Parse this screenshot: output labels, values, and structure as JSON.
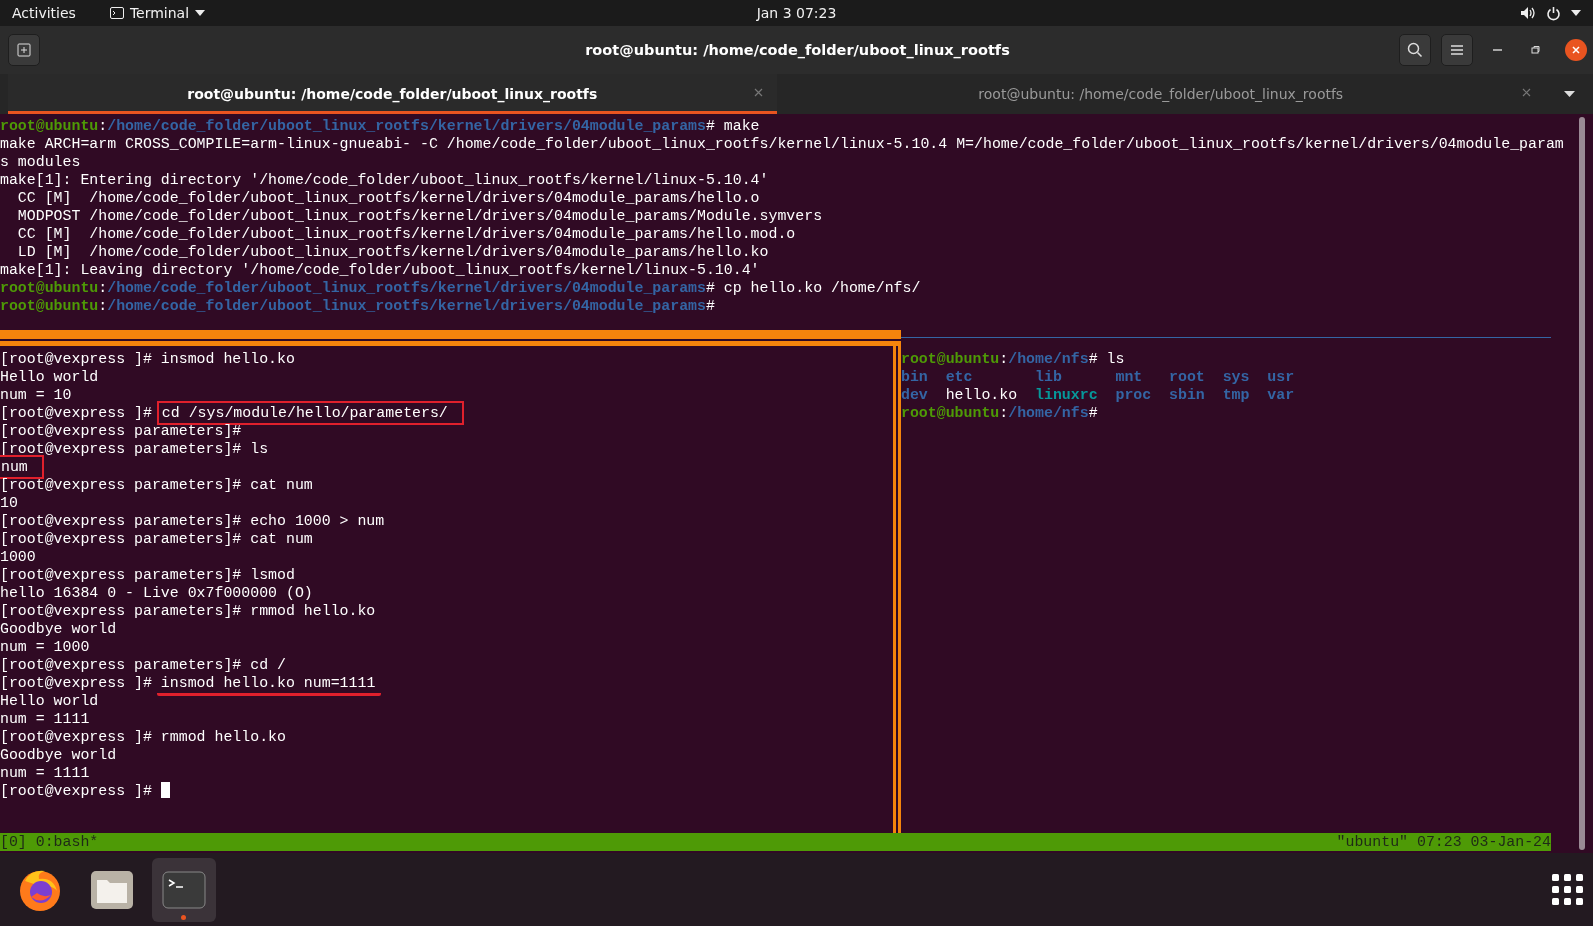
{
  "top_bar": {
    "activities": "Activities",
    "app_menu": "Terminal",
    "clock": "Jan 3  07:23"
  },
  "window": {
    "title": "root@ubuntu: /home/code_folder/uboot_linux_rootfs"
  },
  "tabs": [
    {
      "label": "root@ubuntu: /home/code_folder/uboot_linux_rootfs",
      "selected": true
    },
    {
      "label": "root@ubuntu: /home/code_folder/uboot_linux_rootfs",
      "selected": false
    }
  ],
  "top_pane": {
    "lines": [
      [
        {
          "text": "root@ubuntu",
          "kind": "user"
        },
        {
          "text": ":",
          "kind": "plain"
        },
        {
          "text": "/home/code_folder/uboot_linux_rootfs/kernel/drivers/04module_params",
          "kind": "path"
        },
        {
          "text": "# make",
          "kind": "plain"
        }
      ],
      [
        {
          "text": "make ARCH=arm CROSS_COMPILE=arm-linux-gnueabi- -C /home/code_folder/uboot_linux_rootfs/kernel/linux-5.10.4 M=/home/code_folder/uboot_linux_rootfs/kernel/drivers/04module_param",
          "kind": "plain"
        }
      ],
      [
        {
          "text": "s modules",
          "kind": "plain"
        }
      ],
      [
        {
          "text": "make[1]: Entering directory '/home/code_folder/uboot_linux_rootfs/kernel/linux-5.10.4'",
          "kind": "plain"
        }
      ],
      [
        {
          "text": "  CC [M]  /home/code_folder/uboot_linux_rootfs/kernel/drivers/04module_params/hello.o",
          "kind": "plain"
        }
      ],
      [
        {
          "text": "  MODPOST /home/code_folder/uboot_linux_rootfs/kernel/drivers/04module_params/Module.symvers",
          "kind": "plain"
        }
      ],
      [
        {
          "text": "  CC [M]  /home/code_folder/uboot_linux_rootfs/kernel/drivers/04module_params/hello.mod.o",
          "kind": "plain"
        }
      ],
      [
        {
          "text": "  LD [M]  /home/code_folder/uboot_linux_rootfs/kernel/drivers/04module_params/hello.ko",
          "kind": "plain"
        }
      ],
      [
        {
          "text": "make[1]: Leaving directory '/home/code_folder/uboot_linux_rootfs/kernel/linux-5.10.4'",
          "kind": "plain"
        }
      ],
      [
        {
          "text": "root@ubuntu",
          "kind": "user"
        },
        {
          "text": ":",
          "kind": "plain"
        },
        {
          "text": "/home/code_folder/uboot_linux_rootfs/kernel/drivers/04module_params",
          "kind": "path"
        },
        {
          "text": "# cp hello.ko /home/nfs/",
          "kind": "plain"
        }
      ],
      [
        {
          "text": "root@ubuntu",
          "kind": "user"
        },
        {
          "text": ":",
          "kind": "plain"
        },
        {
          "text": "/home/code_folder/uboot_linux_rootfs/kernel/drivers/04module_params",
          "kind": "path"
        },
        {
          "text": "#",
          "kind": "plain"
        }
      ]
    ]
  },
  "left_pane": {
    "active": true,
    "lines": [
      [
        {
          "text": "[root@vexpress ]# insmod hello.ko",
          "kind": "plain"
        }
      ],
      [
        {
          "text": "Hello world",
          "kind": "plain"
        }
      ],
      [
        {
          "text": "num = 10",
          "kind": "plain"
        }
      ],
      [
        {
          "text": "[root@vexpress ]# ",
          "kind": "plain"
        },
        {
          "text": "cd /sys/module/hello/parameters/",
          "kind": "boxed"
        }
      ],
      [
        {
          "text": "[root@vexpress parameters]#",
          "kind": "plain"
        }
      ],
      [
        {
          "text": "[root@vexpress parameters]# ls",
          "kind": "plain"
        }
      ],
      [
        {
          "text": "num",
          "kind": "boxed"
        }
      ],
      [
        {
          "text": "[root@vexpress parameters]# cat num",
          "kind": "plain"
        }
      ],
      [
        {
          "text": "10",
          "kind": "plain"
        }
      ],
      [
        {
          "text": "[root@vexpress parameters]# echo 1000 > num",
          "kind": "plain"
        }
      ],
      [
        {
          "text": "[root@vexpress parameters]# cat num",
          "kind": "plain"
        }
      ],
      [
        {
          "text": "1000",
          "kind": "plain"
        }
      ],
      [
        {
          "text": "[root@vexpress parameters]# lsmod",
          "kind": "plain"
        }
      ],
      [
        {
          "text": "hello 16384 0 - Live 0x7f000000 (O)",
          "kind": "plain"
        }
      ],
      [
        {
          "text": "[root@vexpress parameters]# rmmod hello.ko",
          "kind": "plain"
        }
      ],
      [
        {
          "text": "Goodbye world",
          "kind": "plain"
        }
      ],
      [
        {
          "text": "num = 1000",
          "kind": "plain"
        }
      ],
      [
        {
          "text": "[root@vexpress parameters]# cd /",
          "kind": "plain"
        }
      ],
      [
        {
          "text": "[root@vexpress ]# ",
          "kind": "plain"
        },
        {
          "text": "insmod hello.ko num=1111",
          "kind": "underlined"
        }
      ],
      [
        {
          "text": "Hello world",
          "kind": "plain"
        }
      ],
      [
        {
          "text": "num = 1111",
          "kind": "plain"
        }
      ],
      [
        {
          "text": "[root@vexpress ]# rmmod hello.ko",
          "kind": "plain"
        }
      ],
      [
        {
          "text": "Goodbye world",
          "kind": "plain"
        }
      ],
      [
        {
          "text": "num = 1111",
          "kind": "plain"
        }
      ],
      [
        {
          "text": "[root@vexpress ]# ",
          "kind": "plain"
        },
        {
          "kind": "cursor"
        }
      ]
    ]
  },
  "right_pane": {
    "active": false,
    "lines": [
      [
        {
          "text": "root@ubuntu",
          "kind": "user"
        },
        {
          "text": ":",
          "kind": "plain"
        },
        {
          "text": "/home/nfs",
          "kind": "path"
        },
        {
          "text": "# ls",
          "kind": "plain"
        }
      ],
      {
        "kind": "listing",
        "rows": [
          [
            {
              "text": "bin",
              "kind": "dir"
            },
            {
              "text": "etc",
              "kind": "dir"
            },
            {
              "text": "lib",
              "kind": "dir"
            },
            {
              "text": "mnt",
              "kind": "dir"
            },
            {
              "text": "root",
              "kind": "dir"
            },
            {
              "text": "sys",
              "kind": "dir"
            },
            {
              "text": "usr",
              "kind": "dir"
            }
          ],
          [
            {
              "text": "dev",
              "kind": "dir"
            },
            {
              "text": "hello.ko",
              "kind": "plain"
            },
            {
              "text": "linuxrc",
              "kind": "exec"
            },
            {
              "text": "proc",
              "kind": "dir"
            },
            {
              "text": "sbin",
              "kind": "dir"
            },
            {
              "text": "tmp",
              "kind": "dir"
            },
            {
              "text": "var",
              "kind": "dir"
            }
          ]
        ]
      },
      [
        {
          "text": "root@ubuntu",
          "kind": "user"
        },
        {
          "text": ":",
          "kind": "plain"
        },
        {
          "text": "/home/nfs",
          "kind": "path"
        },
        {
          "text": "#",
          "kind": "plain"
        }
      ]
    ]
  },
  "status_bar": {
    "left": "[0] 0:bash*",
    "right": "\"ubuntu\" 07:23 03-Jan-24"
  },
  "dock": {
    "items": [
      {
        "kind": "browser",
        "selected": false
      },
      {
        "kind": "files",
        "selected": false
      },
      {
        "kind": "terminal",
        "selected": true
      }
    ]
  }
}
